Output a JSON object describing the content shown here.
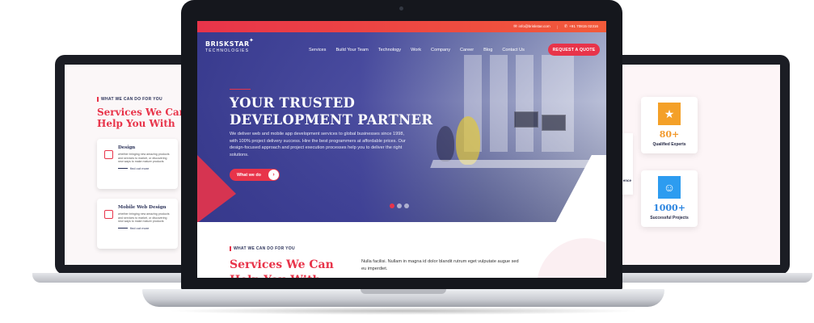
{
  "topbar": {
    "email": "info@briskstar.com",
    "phone": "+91 70815 02316"
  },
  "logo": {
    "name": "BRISKSTAR",
    "sub": "TECHNOLOGIES"
  },
  "nav": {
    "items": [
      "Services",
      "Build Your Team",
      "Technology",
      "Work",
      "Company",
      "Career",
      "Blog",
      "Contact Us"
    ],
    "cta": "REQUEST A QUOTE"
  },
  "hero": {
    "title": "YOUR TRUSTED DEVELOPMENT PARTNER",
    "description": "We deliver web and mobile app development services to global businesses since 1998, with 100% project delivery success. Hire the best programmers at affordable prices. Our design-focused approach and project execution processes help you to deliver the right solutions.",
    "button": "What we do",
    "slides": 3,
    "active_slide": 1
  },
  "services": {
    "eyebrow": "WHAT WE CAN DO FOR YOU",
    "title": "Services We Can Help You With",
    "description": "Nulla facilisi. Nullam in magna id dolor blandit rutrum eget vulputate augue sed eu imperdiet."
  },
  "left_screen": {
    "eyebrow": "WHAT WE CAN DO FOR YOU",
    "title": "Services We Can Help You With",
    "cards": [
      {
        "title": "Design",
        "text": "whether bringing new amazing products and services to market, or discovering new ways to make mature products",
        "link": "find out more"
      },
      {
        "title": "Mobile Web Design",
        "text": "whether bringing new amazing products and services to market, or discovering new ways to make mature products",
        "link": "find out more"
      }
    ]
  },
  "right_screen": {
    "partial_label": "ence",
    "stats": [
      {
        "value": "80+",
        "label": "Qualified Experts",
        "color": "#f4a028"
      },
      {
        "value": "1000+",
        "label": "Successful Projects",
        "color": "#2d9cf0"
      }
    ]
  },
  "colors": {
    "accent": "#e8344a",
    "navy": "#2b3259",
    "hero_overlay": "#34368c"
  }
}
